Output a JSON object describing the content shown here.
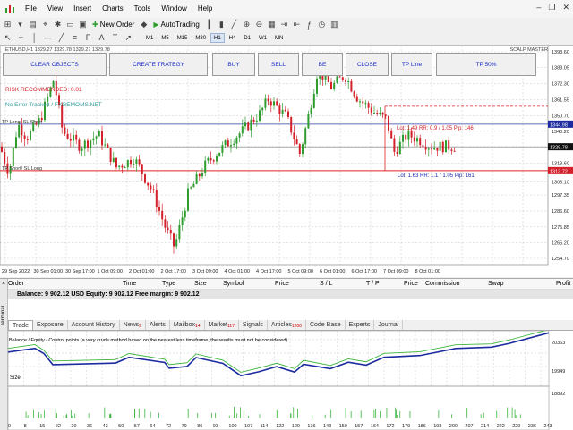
{
  "menu": {
    "items": [
      "File",
      "View",
      "Insert",
      "Charts",
      "Tools",
      "Window",
      "Help"
    ]
  },
  "toolbar": {
    "new_order": "New Order",
    "autotrading": "AutoTrading"
  },
  "timeframes": [
    "M1",
    "M5",
    "M15",
    "M30",
    "H1",
    "H4",
    "D1",
    "W1",
    "MN"
  ],
  "active_timeframe": "H1",
  "chart": {
    "symbol_line": "ETHUSD,H1  1329.27 1329.78 1329.27 1329.78",
    "indicator_name": "SCALP MASTER",
    "buttons": [
      "CLEAR OBJECTS",
      "CREATE TRATEGY",
      "BUY",
      "SELL",
      "BE",
      "CLOSE",
      "TP Line",
      "TP 50%"
    ],
    "risk": "RISK RECOMMENDED: 0.01",
    "tracker": "No Error Tracked / FXGEMOMS.NET",
    "tp_long_sl_short": "TP Long/ SL Short",
    "tp_short_sl_long": "TP Short/ SL Long",
    "lot_upper": "Lot: 1.49  RR: 0.9 / 1.05  Pip: 146",
    "lot_lower": "Lot: 1.63  RR: 1.1 / 1.05  Pip: 161",
    "price_labels": [
      "1393.60",
      "1383.05",
      "1372.30",
      "1361.55",
      "1350.70",
      "1340.20",
      "1329.78",
      "1318.60",
      "1306.10",
      "1297.35",
      "1286.60",
      "1275.85",
      "1265.20",
      "1254.70"
    ],
    "tag_blue": "1344.98",
    "tag_black": "1329.78",
    "tag_red": "1313.72",
    "time_labels": [
      "29 Sep 2022",
      "30 Sep 01:00",
      "30 Sep 17:00",
      "1 Oct 09:00",
      "2 Oct 01:00",
      "2 Oct 17:00",
      "3 Oct 09:00",
      "4 Oct 01:00",
      "4 Oct 17:00",
      "5 Oct 09:00",
      "6 Oct 01:00",
      "6 Oct 17:00",
      "7 Oct 09:00",
      "8 Oct 01:00"
    ]
  },
  "trade": {
    "columns": [
      "Order",
      "Time",
      "Type",
      "Size",
      "Symbol",
      "Price",
      "S / L",
      "T / P",
      "Price",
      "Commission",
      "Swap",
      "Profit"
    ],
    "balance": "Balance: 9 902.12 USD  Equity: 9 902.12  Free margin: 9 902.12"
  },
  "terminal_label": "Terminal",
  "tabs": [
    {
      "label": "Trade"
    },
    {
      "label": "Exposure"
    },
    {
      "label": "Account History"
    },
    {
      "label": "News",
      "badge": "9"
    },
    {
      "label": "Alerts"
    },
    {
      "label": "Mailbox",
      "badge": "14"
    },
    {
      "label": "Market",
      "badge": "117"
    },
    {
      "label": "Signals"
    },
    {
      "label": "Articles",
      "badge": "1200"
    },
    {
      "label": "Code Base"
    },
    {
      "label": "Experts"
    },
    {
      "label": "Journal"
    }
  ],
  "equity": {
    "note": "Balance / Equity / Control points (a very crude method based on the nearest less timeframe, the results must not be considered)",
    "size_label": "Size",
    "y_labels": [
      "20363",
      "19949",
      "18892"
    ],
    "x_labels": [
      "0",
      "8",
      "15",
      "22",
      "29",
      "36",
      "43",
      "50",
      "57",
      "64",
      "72",
      "79",
      "86",
      "93",
      "100",
      "107",
      "114",
      "122",
      "129",
      "136",
      "143",
      "150",
      "157",
      "164",
      "172",
      "179",
      "186",
      "193",
      "200",
      "207",
      "214",
      "222",
      "229",
      "236",
      "243"
    ]
  },
  "colors": {
    "bull": "#2e9d2e",
    "bear": "#d4202a",
    "balance": "#1c2ca0",
    "equity": "#3cb43c",
    "btn_text": "#1a2cc8"
  }
}
